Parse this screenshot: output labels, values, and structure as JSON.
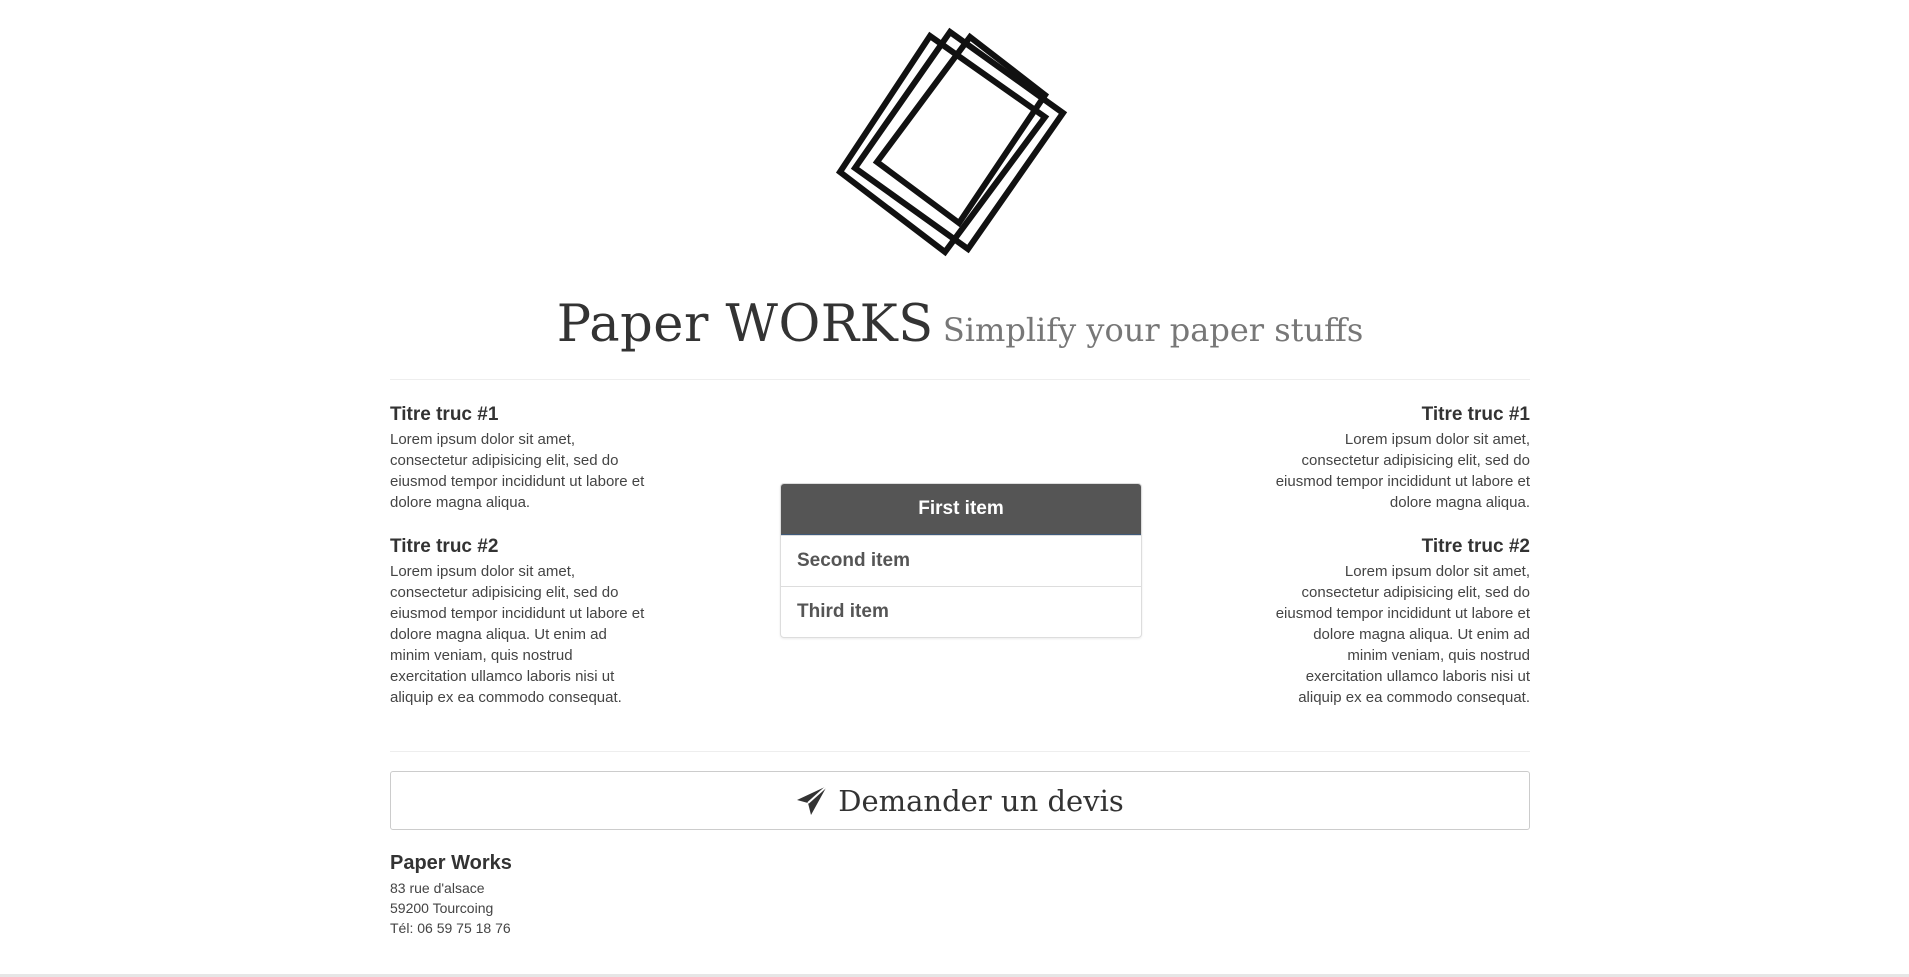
{
  "header": {
    "logo_icon": "paper-sheets-icon",
    "title": "Paper WORKS",
    "subtitle": "Simplify your paper stuffs"
  },
  "left_column": [
    {
      "title": "Titre truc #1",
      "text": "Lorem ipsum dolor sit amet, consectetur adipisicing elit, sed do eiusmod tempor incididunt ut labore et dolore magna aliqua."
    },
    {
      "title": "Titre truc #2",
      "text": "Lorem ipsum dolor sit amet, consectetur adipisicing elit, sed do eiusmod tempor incididunt ut labore et dolore magna aliqua. Ut enim ad minim veniam, quis nostrud exercitation ullamco laboris nisi ut aliquip ex ea commodo consequat."
    }
  ],
  "right_column": [
    {
      "title": "Titre truc #1",
      "text": "Lorem ipsum dolor sit amet, consectetur adipisicing elit, sed do eiusmod tempor incididunt ut labore et dolore magna aliqua."
    },
    {
      "title": "Titre truc #2",
      "text": "Lorem ipsum dolor sit amet, consectetur adipisicing elit, sed do eiusmod tempor incididunt ut labore et dolore magna aliqua. Ut enim ad minim veniam, quis nostrud exercitation ullamco laboris nisi ut aliquip ex ea commodo consequat."
    }
  ],
  "list_group": {
    "items": [
      "First item",
      "Second item",
      "Third item"
    ],
    "active_color": "#555555"
  },
  "cta": {
    "icon": "paper-plane-icon",
    "label": "Demander un devis"
  },
  "footer": {
    "company": "Paper Works",
    "address_line1": "83 rue d'alsace",
    "address_line2": "59200 Tourcoing",
    "phone": "Tél: 06 59 75 18 76"
  }
}
